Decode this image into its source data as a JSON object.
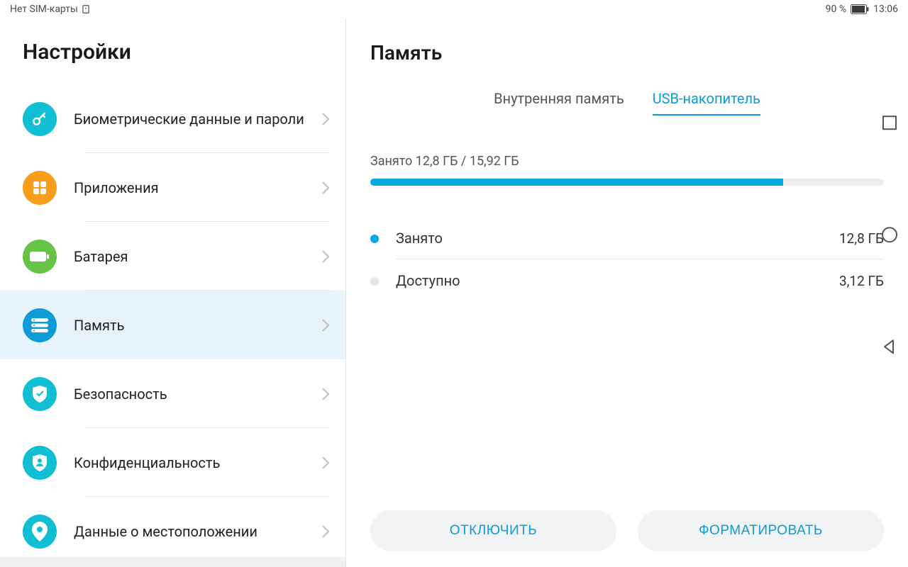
{
  "statusbar": {
    "sim_text": "Нет SIM-карты",
    "battery_pct": "90 %",
    "clock": "13:06"
  },
  "sidebar": {
    "title": "Настройки",
    "items": [
      {
        "label": "Биометрические данные и пароли",
        "icon": "key",
        "bg": "#11bfd5"
      },
      {
        "label": "Приложения",
        "icon": "apps",
        "bg": "#f89c1c"
      },
      {
        "label": "Батарея",
        "icon": "battery",
        "bg": "#65c445"
      },
      {
        "label": "Память",
        "icon": "storage",
        "bg": "#0d9cd8",
        "active": true
      },
      {
        "label": "Безопасность",
        "icon": "shield-check",
        "bg": "#11bfd5"
      },
      {
        "label": "Конфиденциальность",
        "icon": "shield-user",
        "bg": "#11bfd5"
      },
      {
        "label": "Данные о местоположении",
        "icon": "location",
        "bg": "#11bfd5"
      }
    ]
  },
  "content": {
    "title": "Память",
    "tabs": [
      {
        "label": "Внутренняя память",
        "active": false
      },
      {
        "label": "USB-накопитель",
        "active": true
      }
    ],
    "usage_line": "Занято 12,8 ГБ / 15,92 ГБ",
    "progress_percent": 80.4,
    "breakdown": [
      {
        "label": "Занято",
        "value": "12,8 ГБ",
        "color": "#06aae0"
      },
      {
        "label": "Доступно",
        "value": "3,12 ГБ",
        "color": "#e6e6e6"
      }
    ],
    "buttons": {
      "eject": "ОТКЛЮЧИТЬ",
      "format": "ФОРМАТИРОВАТЬ"
    }
  }
}
